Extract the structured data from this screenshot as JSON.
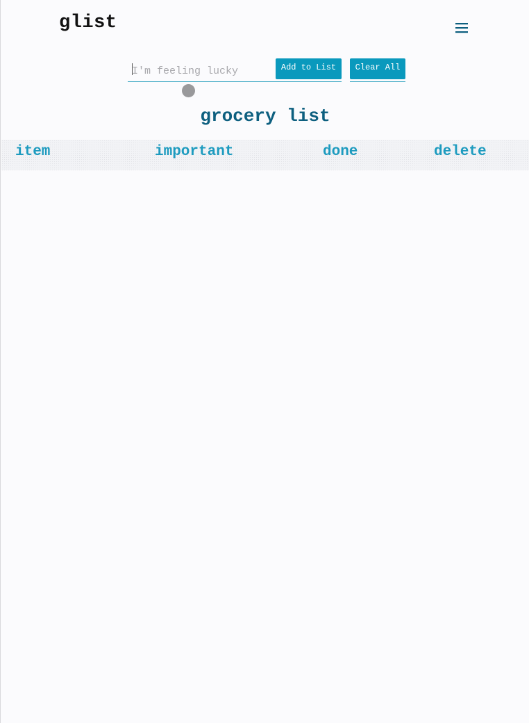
{
  "app": {
    "brand": "glist"
  },
  "header": {
    "menu_icon": "hamburger-menu-icon",
    "accent_color": "#0d5f7f"
  },
  "form": {
    "input_placeholder": "I'm feeling lucky",
    "input_value": "",
    "add_label": "Add to List",
    "clear_label": "Clear All",
    "button_color": "#0a99bd"
  },
  "list": {
    "title": "grocery list",
    "columns": [
      "item",
      "important",
      "done",
      "delete"
    ],
    "column_color": "#1d9bbf",
    "rows": []
  }
}
